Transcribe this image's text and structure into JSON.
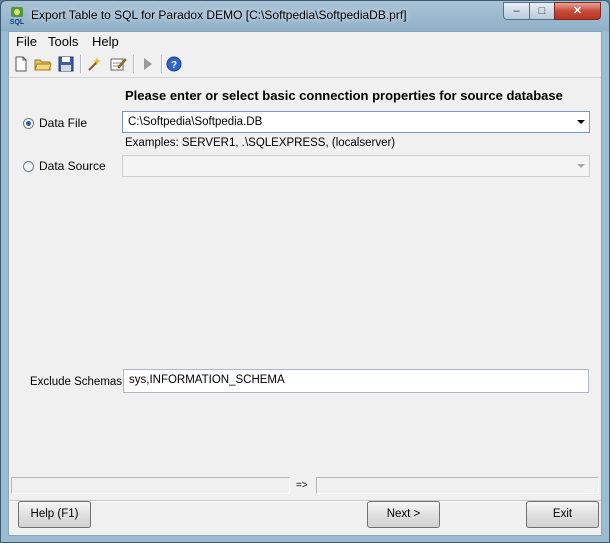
{
  "window": {
    "title": "Export Table to SQL for Paradox DEMO [C:\\Softpedia\\SoftpediaDB.prf]",
    "controls": {
      "minimize": "–",
      "maximize": "□",
      "close": "✕"
    }
  },
  "menubar": {
    "items": [
      "File",
      "Tools",
      "Help"
    ]
  },
  "toolbar": {
    "icons": [
      "new-file-icon",
      "open-folder-icon",
      "save-disk-icon",
      "run-wizard-icon",
      "edit-properties-icon",
      "play-icon",
      "help-icon"
    ]
  },
  "main": {
    "heading": "Please enter or select basic connection properties for source database",
    "data_file": {
      "label": "Data File",
      "value": "C:\\Softpedia\\Softpedia.DB",
      "selected": true
    },
    "examples": "Examples: SERVER1, .\\SQLEXPRESS, (localserver)",
    "data_source": {
      "label": "Data Source",
      "value": "",
      "selected": false
    },
    "exclude_schemas": {
      "label": "Exclude Schemas",
      "value": "sys,INFORMATION_SCHEMA"
    }
  },
  "statusbar": {
    "left": "",
    "arrow": "=>",
    "right": ""
  },
  "buttons": {
    "help": "Help (F1)",
    "next": "Next >",
    "exit": "Exit"
  },
  "colors": {
    "accent": "#2a5caa",
    "titlebar": "#8fb0c8",
    "close": "#c74a3a"
  }
}
